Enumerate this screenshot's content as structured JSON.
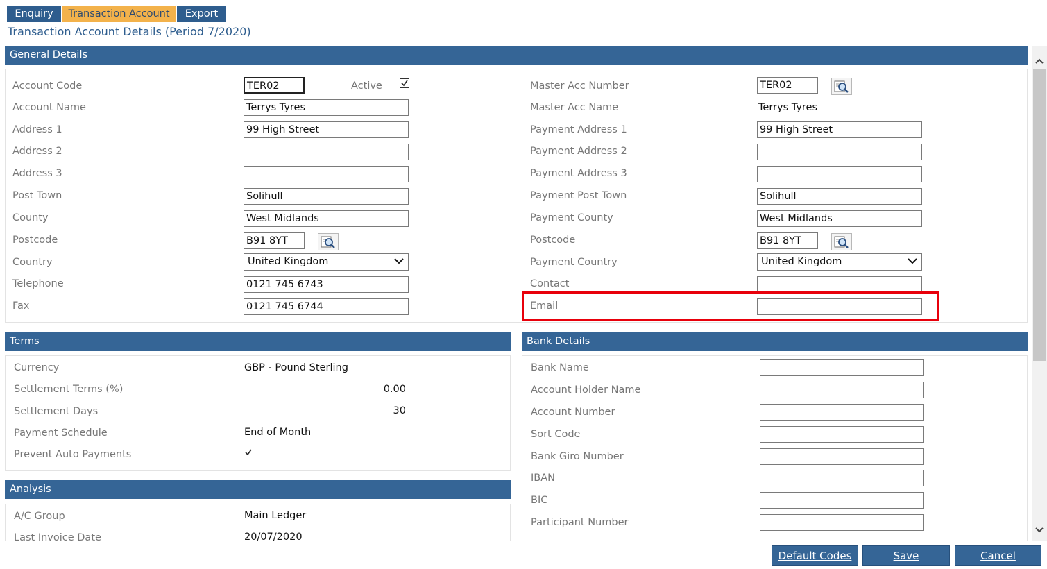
{
  "tabs": [
    {
      "label": "Enquiry"
    },
    {
      "label": "Transaction Account"
    },
    {
      "label": "Export"
    }
  ],
  "page_title": "Transaction Account Details (Period 7/2020)",
  "general": {
    "header": "General Details",
    "account_code_label": "Account Code",
    "account_code": "TER02",
    "active_label": "Active",
    "active_checked": true,
    "account_name_label": "Account Name",
    "account_name": "Terrys Tyres",
    "address1_label": "Address 1",
    "address1": "99 High Street",
    "address2_label": "Address 2",
    "address2": "",
    "address3_label": "Address 3",
    "address3": "",
    "post_town_label": "Post Town",
    "post_town": "Solihull",
    "county_label": "County",
    "county": "West Midlands",
    "postcode_label": "Postcode",
    "postcode": "B91 8YT",
    "country_label": "Country",
    "country": "United Kingdom",
    "telephone_label": "Telephone",
    "telephone": "0121 745 6743",
    "fax_label": "Fax",
    "fax": "0121 745 6744",
    "master_acc_number_label": "Master Acc Number",
    "master_acc_number": "TER02",
    "master_acc_name_label": "Master Acc Name",
    "master_acc_name": "Terrys Tyres",
    "payment_address1_label": "Payment Address 1",
    "payment_address1": "99 High Street",
    "payment_address2_label": "Payment Address 2",
    "payment_address2": "",
    "payment_address3_label": "Payment Address 3",
    "payment_address3": "",
    "payment_post_town_label": "Payment Post Town",
    "payment_post_town": "Solihull",
    "payment_county_label": "Payment County",
    "payment_county": "West Midlands",
    "payment_postcode_label": "Postcode",
    "payment_postcode": "B91 8YT",
    "payment_country_label": "Payment Country",
    "payment_country": "United Kingdom",
    "contact_label": "Contact",
    "contact": "",
    "email_label": "Email",
    "email": ""
  },
  "terms": {
    "header": "Terms",
    "currency_label": "Currency",
    "currency": "GBP - Pound Sterling",
    "settlement_terms_label": "Settlement Terms (%)",
    "settlement_terms": "0.00",
    "settlement_days_label": "Settlement Days",
    "settlement_days": "30",
    "payment_schedule_label": "Payment Schedule",
    "payment_schedule": "End of Month",
    "prevent_auto_label": "Prevent Auto Payments",
    "prevent_auto_checked": true
  },
  "analysis": {
    "header": "Analysis",
    "ac_group_label": "A/C Group",
    "ac_group": "Main Ledger",
    "last_invoice_label": "Last Invoice Date",
    "last_invoice": "20/07/2020"
  },
  "bank": {
    "header": "Bank Details",
    "bank_name_label": "Bank Name",
    "account_holder_label": "Account Holder Name",
    "account_number_label": "Account Number",
    "sort_code_label": "Sort Code",
    "bank_giro_label": "Bank Giro Number",
    "iban_label": "IBAN",
    "bic_label": "BIC",
    "participant_label": "Participant Number"
  },
  "buttons": {
    "default_codes": "Default Codes",
    "save": "Save",
    "cancel": "Cancel"
  },
  "colors": {
    "header_blue": "#356596",
    "tab_active": "#f3b24b",
    "highlight": "#e8000b"
  }
}
